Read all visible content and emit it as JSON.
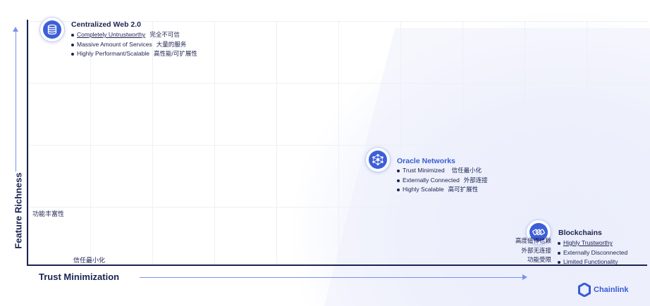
{
  "axes": {
    "y_label": "Feature Richness",
    "x_label": "Trust Minimization",
    "y_cn": "功能丰富性",
    "x_cn": "信任最小化"
  },
  "centralized": {
    "title": "Centralized Web 2.0",
    "items": [
      {
        "en": "Completely Untrustworthy",
        "cn": "完全不可信"
      },
      {
        "en": "Massive Amount of Services",
        "cn": "大量的服务"
      },
      {
        "en": "Highly Performant/Scalable",
        "cn": "高性能/可扩展性"
      }
    ]
  },
  "oracle": {
    "title": "Oracle Networks",
    "items": [
      {
        "en": "Trust Minimized",
        "cn": "信任最小化"
      },
      {
        "en": "Externally Connected",
        "cn": "外部连接"
      },
      {
        "en": "Highly Scalable",
        "cn": "高可扩展性"
      }
    ]
  },
  "blockchains": {
    "title": "Blockchains",
    "items": [
      {
        "en": "Highly Trustworthy"
      },
      {
        "en": "Externally Disconnected"
      },
      {
        "en": "Limited Functionality"
      }
    ],
    "cn": [
      "高度值得信赖",
      "外部无连接",
      "功能受限"
    ]
  },
  "brand": {
    "name": "Chainlink"
  },
  "colors": {
    "accent": "#375bd2",
    "text": "#1b2350",
    "arrow": "#7c92e8"
  }
}
